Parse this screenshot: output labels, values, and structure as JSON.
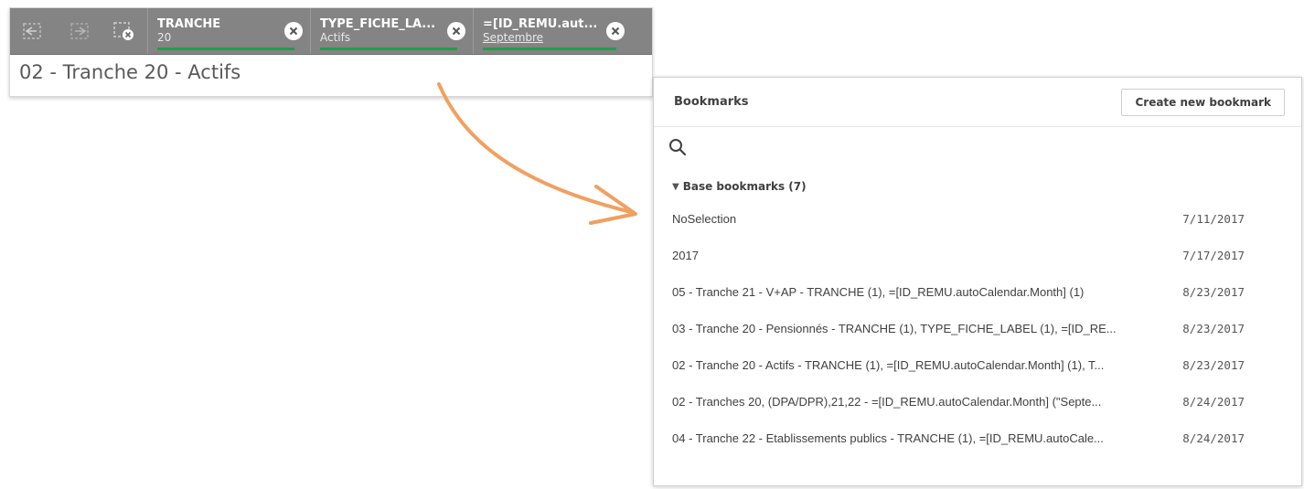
{
  "selection_bar": {
    "tools": [
      {
        "icon": "step-back-icon"
      },
      {
        "icon": "step-forward-icon"
      },
      {
        "icon": "clear-selections-icon"
      }
    ],
    "chips": [
      {
        "field": "TRANCHE",
        "value": "20"
      },
      {
        "field": "TYPE_FICHE_LA...",
        "value": "Actifs"
      },
      {
        "field": "=[ID_REMU.aut...",
        "value": "Septembre"
      }
    ],
    "accent": "#1f9e4a"
  },
  "sheet": {
    "title": "02 - Tranche 20 - Actifs"
  },
  "bookmarks": {
    "title": "Bookmarks",
    "create_label": "Create new bookmark",
    "search_icon": "search-icon",
    "group": {
      "label": "Base bookmarks (7)",
      "expanded": true
    },
    "items": [
      {
        "name": "NoSelection",
        "date": "7/11/2017"
      },
      {
        "name": "2017",
        "date": "7/17/2017"
      },
      {
        "name": "05 - Tranche 21 - V+AP - TRANCHE (1), =[ID_REMU.autoCalendar.Month] (1)",
        "date": "8/23/2017"
      },
      {
        "name": "03 - Tranche 20 - Pensionnés - TRANCHE (1), TYPE_FICHE_LABEL (1), =[ID_RE...",
        "date": "8/23/2017"
      },
      {
        "name": "02 - Tranche 20 - Actifs - TRANCHE (1), =[ID_REMU.autoCalendar.Month] (1), T...",
        "date": "8/23/2017"
      },
      {
        "name": "02 - Tranches 20, (DPA/DPR),21,22 - =[ID_REMU.autoCalendar.Month] (\"Septe...",
        "date": "8/24/2017"
      },
      {
        "name": "04 - Tranche 22 - Etablissements publics - TRANCHE (1), =[ID_REMU.autoCale...",
        "date": "8/24/2017"
      }
    ]
  },
  "arrow_color": "#f0a060"
}
